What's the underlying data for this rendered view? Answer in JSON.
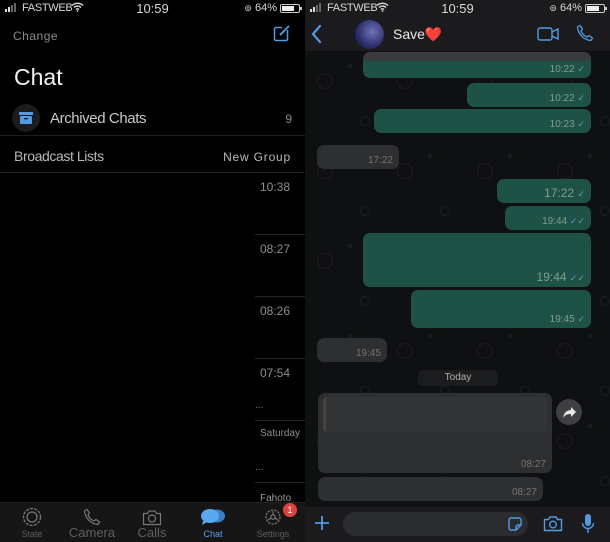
{
  "colors": {
    "accent": "#56a4ee",
    "outgoing_bubble": "#1e5246",
    "incoming_bubble": "#2e2f31",
    "badge": "#e0413c"
  },
  "left": {
    "status": {
      "carrier": "FASTWEB",
      "time": "10:59",
      "battery": "64%",
      "battery_level": 0.64
    },
    "header": {
      "change_label": "Change",
      "compose_icon": "compose-icon"
    },
    "title": "Chat",
    "archived": {
      "label": "Archived Chats",
      "count": "9",
      "icon": "archive-icon"
    },
    "broadcast_label": "Broadcast Lists",
    "new_group_label": "New Group",
    "chats": [
      {
        "time": "10:38"
      },
      {
        "time": "08:27"
      },
      {
        "time": "08:26"
      },
      {
        "time": "07:54",
        "preview": "..."
      },
      {
        "time": "Saturday",
        "preview": "..."
      }
    ],
    "peek_text": "Fahoto",
    "tabs": [
      {
        "label": "State",
        "icon": "status-icon"
      },
      {
        "label": "Camera",
        "icon": "phone-icon"
      },
      {
        "label": "Calls",
        "icon": "camera-icon"
      },
      {
        "label": "Chat",
        "icon": "chat-bubbles-icon",
        "active": true
      },
      {
        "label": "Settings",
        "icon": "gear-icon",
        "badge": "1"
      }
    ]
  },
  "right": {
    "status": {
      "carrier": "FASTWEB",
      "time": "10:59",
      "battery": "64%",
      "battery_level": 0.64
    },
    "contact": {
      "name": "Save",
      "emoji": "❤️"
    },
    "messages": [
      {
        "dir": "out",
        "time": "10:22",
        "check": "✓",
        "quoted": true
      },
      {
        "dir": "out",
        "time": "10:22",
        "check": "✓"
      },
      {
        "dir": "out",
        "time": "10:23",
        "check": "✓"
      },
      {
        "dir": "in",
        "time": "17:22"
      },
      {
        "dir": "out",
        "time": "17:22",
        "check": "✓"
      },
      {
        "dir": "out",
        "time": "19:44",
        "check": "✓✓"
      },
      {
        "dir": "out",
        "time": "19:44",
        "check": "✓✓"
      },
      {
        "dir": "out",
        "time": "19:45",
        "check": "✓"
      },
      {
        "dir": "in",
        "time": "19:45"
      },
      {
        "dir": "in",
        "time": "08:27",
        "forwardable": true
      },
      {
        "dir": "in",
        "time": "08:27"
      }
    ],
    "date_separator": "Today",
    "input": {
      "value": "",
      "placeholder": ""
    }
  }
}
